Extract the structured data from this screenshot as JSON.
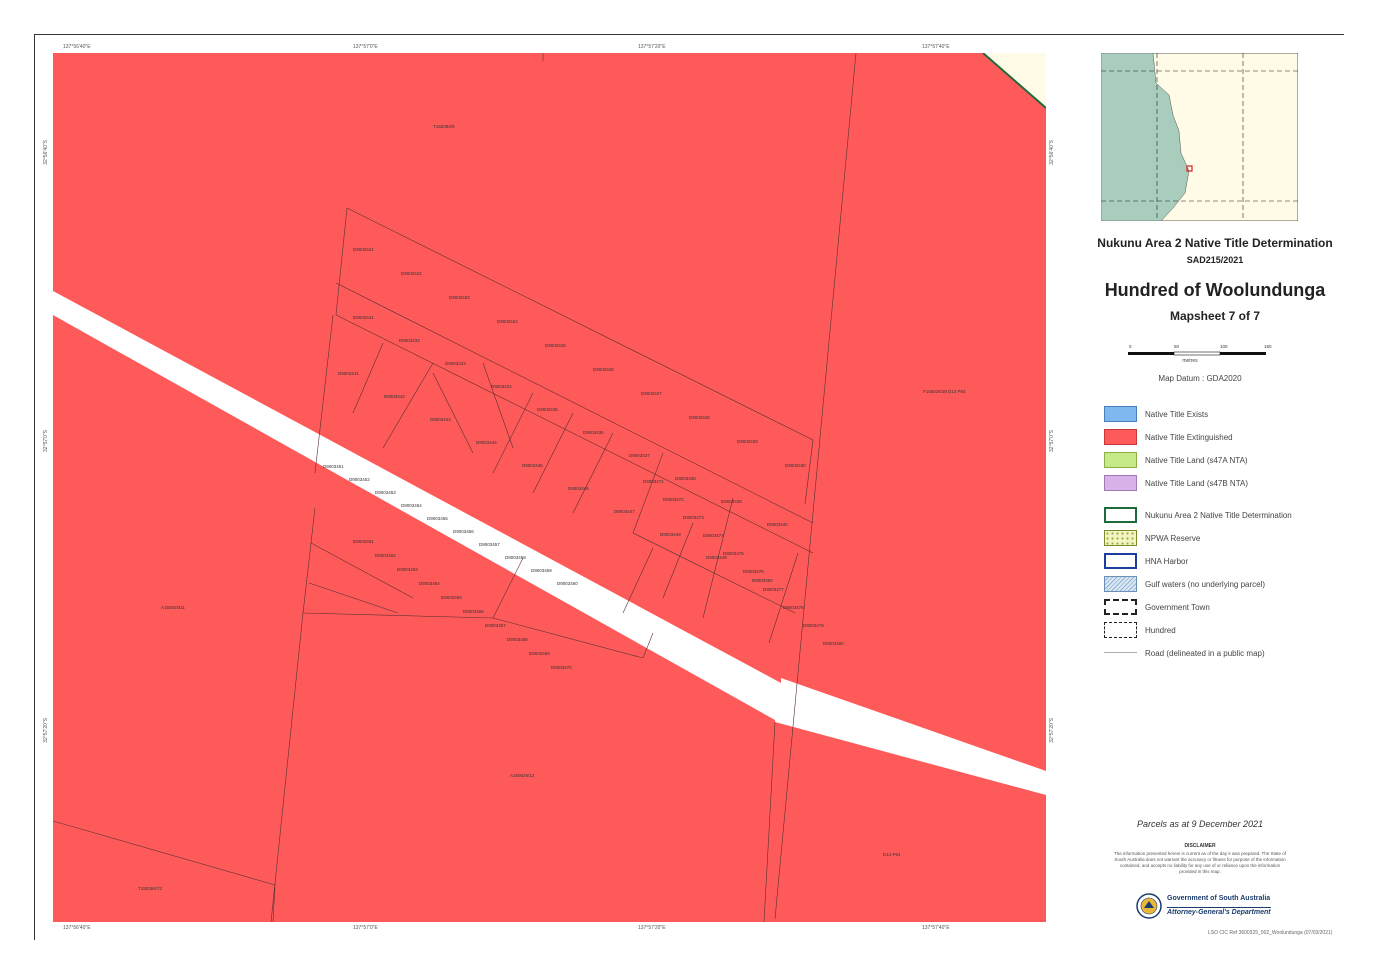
{
  "header": {
    "title": "Nukunu Area 2 Native Title Determination",
    "case_number": "SAD215/2021",
    "hundred": "Hundred of Woolundunga",
    "mapsheet": "Mapsheet 7 of 7"
  },
  "scale": {
    "ticks": [
      "0",
      "50",
      "100",
      "150"
    ],
    "units": "metres",
    "datum": "Map Datum : GDA2020"
  },
  "legend": [
    {
      "label": "Native Title Exists",
      "color": "#7fb7ef",
      "style": "fill"
    },
    {
      "label": "Native Title Extinguished",
      "color": "#ff5a5a",
      "style": "fill"
    },
    {
      "label": "Native Title Land (s47A NTA)",
      "color": "#c8e98a",
      "style": "fill"
    },
    {
      "label": "Native Title Land (s47B NTA)",
      "color": "#d8b2e8",
      "style": "fill"
    },
    {
      "label": "Nukunu Area 2 Native Title Determination",
      "color": "#1d6b3b",
      "style": "outline"
    },
    {
      "label": "NPWA Reserve",
      "color": "#9aa84a",
      "style": "dotted"
    },
    {
      "label": "HNA Harbor",
      "color": "#1a3ea0",
      "style": "outline"
    },
    {
      "label": "Gulf waters (no underlying parcel)",
      "color": "#6a8fb8",
      "style": "hatched"
    },
    {
      "label": "Government Town",
      "color": "#222222",
      "style": "dash-dot"
    },
    {
      "label": "Hundred",
      "color": "#222222",
      "style": "dashed"
    },
    {
      "label": "Road (delineated in a public map)",
      "color": "#aaaaaa",
      "style": "line"
    }
  ],
  "footer": {
    "parcels_date": "Parcels as at 9 December 2021",
    "disclaimer_title": "DISCLAIMER",
    "disclaimer_text": "The information presented herein is current as of the day it was prepared. The State of South Australia does not warrant the accuracy or fitness for purpose of the information contained, and accepts no liability for any use of or reliance upon the information provided in this map.",
    "gov_name": "Government of South Australia",
    "department": "Attorney-General's Department",
    "doc_ref": "LSO CIC Ref 3600325_002_Woolundunga (07/03/2021)"
  },
  "map": {
    "colors": {
      "extinguished": "#ff5a5a",
      "road": "#ffffff",
      "outside": "#fffbe6",
      "boundary": "#1d6b3b",
      "parcel_line": "#5a3030"
    },
    "large_parcels": [
      "T160394/9",
      "A150026/11",
      "A150026/12",
      "T150394/72",
      "F150026/38",
      "D14 P64",
      "D12 P64"
    ],
    "small_parcels": [
      "D9003421",
      "D9003422",
      "D9003423",
      "D9003424",
      "D9003425",
      "D9003426",
      "D9003427",
      "D9003428",
      "D9003429",
      "D9003430",
      "D9003431",
      "D9003432",
      "D9003433",
      "D9003434",
      "D9003435",
      "D9003436",
      "D9003437",
      "D9003438",
      "D9003439",
      "D9003440",
      "D9003441",
      "D9003442",
      "D9003443",
      "D9003444",
      "D9003445",
      "D9003446",
      "D9003447",
      "D9003448",
      "D9003449",
      "D9003450",
      "D9003451",
      "D9003452",
      "D9003453",
      "D9003454",
      "D9003455",
      "D9003456",
      "D9003457",
      "D9003458",
      "D9003459",
      "D9003460",
      "D9003461",
      "D9003462",
      "D9003463",
      "D9003464",
      "D9003465",
      "D9003466",
      "D9003467",
      "D9003468",
      "D9003469",
      "D9003470",
      "D9003471",
      "D9003472",
      "D9003473",
      "D9003474",
      "D9003475",
      "D9003476",
      "D9003477",
      "D9003478",
      "D9003479",
      "D9003480"
    ],
    "grid_top": [
      "137°56'40\"E",
      "137°57'0\"E",
      "137°57'20\"E",
      "137°57'40\"E"
    ],
    "grid_side": [
      "32°56'40\"S",
      "32°57'0\"S",
      "32°57'20\"S"
    ]
  },
  "inset": {
    "colors": {
      "sea": "#a8cdbd",
      "land": "#fffbe6",
      "marker": "#d62020"
    }
  }
}
